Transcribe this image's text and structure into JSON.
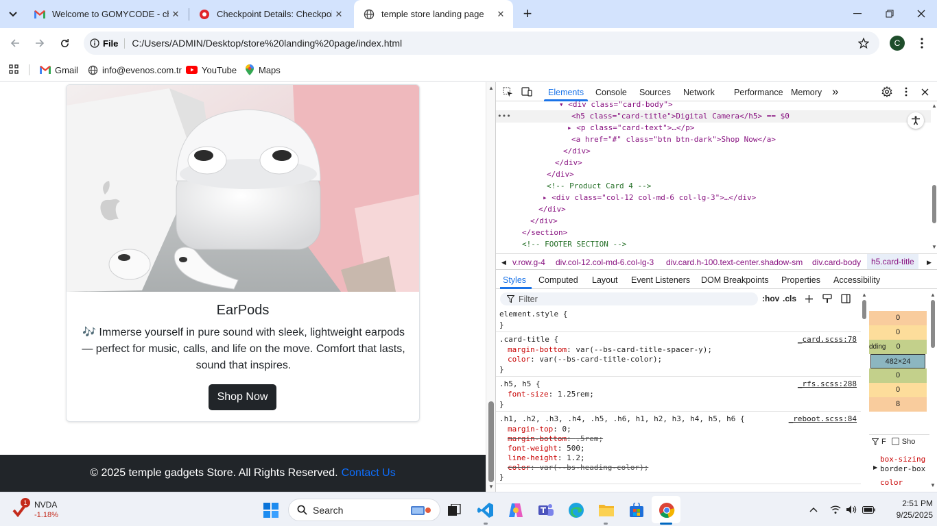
{
  "browser": {
    "tabs": [
      {
        "title": "Welcome to GOMYCODE - chiji",
        "favicon": "gmail-icon"
      },
      {
        "title": "Checkpoint Details: Checkpoint",
        "favicon": "gomycode-icon"
      },
      {
        "title": "temple store landing page",
        "favicon": "globe-icon"
      }
    ],
    "new_tab": "+",
    "address": {
      "scheme_label": "File",
      "url": "C:/Users/ADMIN/Desktop/store%20landing%20page/index.html"
    },
    "profile_initial": "C",
    "bookmarks": [
      {
        "label": "Gmail",
        "icon": "gmail-icon"
      },
      {
        "label": "info@evenos.com.tr",
        "icon": "globe-icon"
      },
      {
        "label": "YouTube",
        "icon": "youtube-icon"
      },
      {
        "label": "Maps",
        "icon": "maps-icon"
      }
    ]
  },
  "page": {
    "card": {
      "title": "EarPods",
      "emoji": "🎶",
      "text": "Immerse yourself in pure sound with sleek, lightweight earpods — perfect for music, calls, and life on the move. Comfort that lasts, sound that inspires.",
      "button": "Shop Now"
    },
    "footer": {
      "text": "© 2025 temple gadgets Store. All Rights Reserved.",
      "link": "Contact Us"
    }
  },
  "devtools": {
    "tabs": [
      "Elements",
      "Console",
      "Sources",
      "Network",
      "Performance",
      "Memory"
    ],
    "more_tabs": "»",
    "dom_lines": [
      "<div class=\"card-body\">",
      "<h5 class=\"card-title\">Digital Camera</h5> == $0",
      "<p class=\"card-text\">…</p>",
      "<a href=\"#\" class=\"btn btn-dark\">Shop Now</a>",
      "</div>",
      "</div>",
      "</div>",
      "<!-- Product Card 4 -->",
      "<div class=\"col-12 col-md-6 col-lg-3\">…</div>",
      "</div>",
      "</div>",
      "</section>",
      "<!-- FOOTER SECTION -->"
    ],
    "breadcrumbs": [
      "v.row.g-4",
      "div.col-12.col-md-6.col-lg-3",
      "div.card.h-100.text-center.shadow-sm",
      "div.card-body",
      "h5.card-title"
    ],
    "styles_tabs": [
      "Styles",
      "Computed",
      "Layout",
      "Event Listeners",
      "DOM Breakpoints",
      "Properties",
      "Accessibility"
    ],
    "filter_placeholder": "Filter",
    "filter_tools": [
      ":hov",
      ".cls"
    ],
    "rules": [
      {
        "selector": "element.style {",
        "source": "",
        "props": [],
        "close": "}"
      },
      {
        "selector": ".card-title {",
        "source": "_card.scss:78",
        "props": [
          {
            "name": "margin-bottom",
            "value": "var(--bs-card-title-spacer-y);",
            "struck": false
          },
          {
            "name": "color",
            "value": "var(--bs-card-title-color);",
            "struck": false
          }
        ],
        "close": "}"
      },
      {
        "selector": ".h5, h5 {",
        "source": "_rfs.scss:288",
        "props": [
          {
            "name": "font-size",
            "value": "1.25rem;",
            "struck": false
          }
        ],
        "close": "}"
      },
      {
        "selector": ".h1, .h2, .h3, .h4, .h5, .h6, h1, h2, h3, h4, h5, h6 {",
        "source": "_reboot.scss:84",
        "props": [
          {
            "name": "margin-top",
            "value": "0;",
            "struck": false
          },
          {
            "name": "margin-bottom",
            "value": ".5rem;",
            "struck": true
          },
          {
            "name": "font-weight",
            "value": "500;",
            "struck": false
          },
          {
            "name": "line-height",
            "value": "1.2;",
            "struck": false
          },
          {
            "name": "color",
            "value": "var(--bs-heading-color);",
            "struck": true
          }
        ],
        "close": "}"
      }
    ],
    "box_model": {
      "values": [
        "0",
        "0",
        "0",
        "482×24",
        "0",
        "0",
        "8"
      ],
      "padding_label": "dding"
    },
    "computed": {
      "filter_label": "F",
      "show_label": "Sho",
      "props": [
        "box-sizing",
        "border-box",
        "color"
      ]
    }
  },
  "taskbar": {
    "stock": {
      "badge": "1",
      "name": "NVDA",
      "change": "-1.18%"
    },
    "search_placeholder": "Search",
    "time": "2:51 PM",
    "date": "9/25/2025"
  },
  "colors": {
    "tab_strip": "#d3e3fd",
    "footer_bg": "#212529",
    "link": "#0d6efd",
    "devtools_accent": "#1a73e8"
  }
}
